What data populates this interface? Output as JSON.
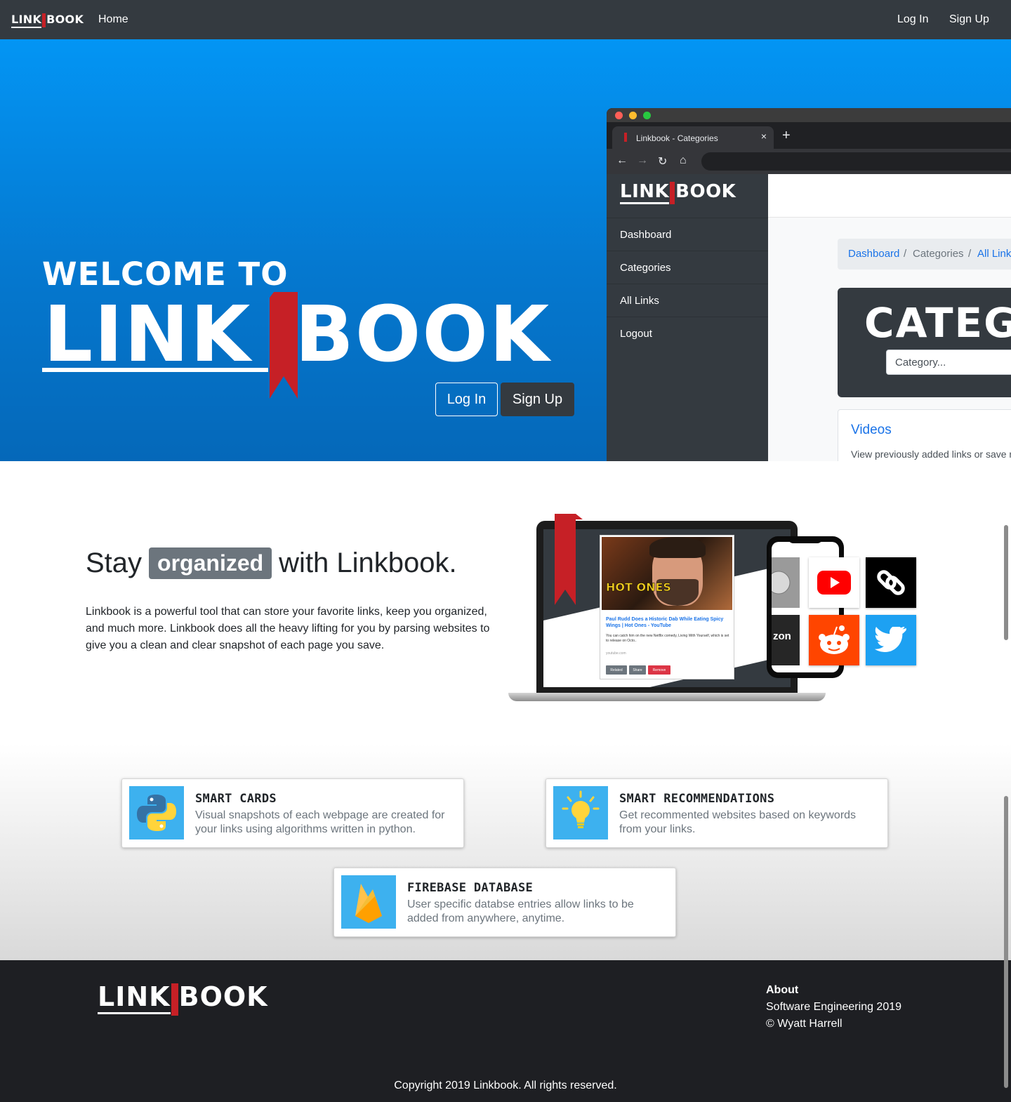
{
  "navbar": {
    "logo_left": "LINK",
    "logo_right": "BOOK",
    "home": "Home",
    "login": "Log In",
    "signup": "Sign Up"
  },
  "hero": {
    "welcome": "WELCOME TO",
    "logo_left": "LINK",
    "logo_right": "BOOK",
    "login": "Log In",
    "signup": "Sign Up"
  },
  "browser": {
    "tab_title": "Linkbook - Categories",
    "tab_close": "×",
    "new_tab": "+",
    "sidebar_logo_left": "LINK",
    "sidebar_logo_right": "BOOK",
    "sidebar_items": [
      "Dashboard",
      "Categories",
      "All Links",
      "Logout"
    ],
    "breadcrumb": [
      "Dashboard",
      "Categories",
      "All Link"
    ],
    "breadcrumb_sep": "/",
    "category_title": "CATEG",
    "category_placeholder": "Category...",
    "video_title": "Videos",
    "video_desc": "View previously added links or save r"
  },
  "organized": {
    "pre": "Stay",
    "badge": "organized",
    "post": "with Linkbook.",
    "desc": "Linkbook is a powerful tool that can store your favorite links, keep you organized, and much more. Linkbook does all the heavy lifting for you by parsing websites to give you a clean and clear snapshot of each page you save."
  },
  "illustration": {
    "card_title": "Paul Rudd Does a Historic Dab While Eating Spicy Wings | Hot Ones - YouTube",
    "card_sub": "You can catch him on the new Netflix comedy, Living With Yourself, which is set to release on Octo..",
    "card_url": "youtube.com",
    "hot_ones": "HOT ONES",
    "buttons": [
      "Related",
      "Share",
      "Remove"
    ],
    "amazon_fragment": "zon"
  },
  "features": [
    {
      "title": "SMART CARDS",
      "desc": "Visual snapshots of each webpage are created for your links using algorithms written in python.",
      "icon": "python-icon"
    },
    {
      "title": "SMART RECOMMENDATIONS",
      "desc": "Get recommented websites based on keywords from your links.",
      "icon": "lightbulb-icon"
    },
    {
      "title": "FIREBASE DATABASE",
      "desc": "User specific databse entries allow links to be added from anywhere, anytime.",
      "icon": "firebase-icon"
    }
  ],
  "footer": {
    "logo_left": "LINK",
    "logo_right": "BOOK",
    "about_heading": "About",
    "about_line1": "Software Engineering 2019",
    "about_line2": "© Wyatt Harrell",
    "copyright": "Copyright 2019 Linkbook. All rights reserved."
  },
  "colors": {
    "brand_red": "#c62026",
    "navbar": "#343a40",
    "hero_blue": "#0395f4",
    "link_blue": "#1a73e8",
    "footer": "#1e1f23"
  }
}
